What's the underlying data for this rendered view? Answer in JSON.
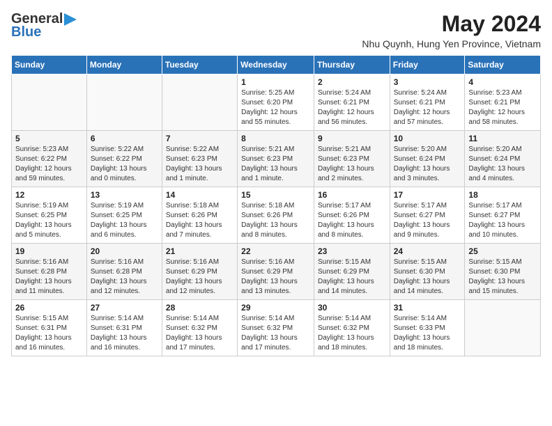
{
  "logo": {
    "line1": "General",
    "line2": "Blue",
    "arrow": "▶"
  },
  "title": {
    "month_year": "May 2024",
    "location": "Nhu Quynh, Hung Yen Province, Vietnam"
  },
  "weekdays": [
    "Sunday",
    "Monday",
    "Tuesday",
    "Wednesday",
    "Thursday",
    "Friday",
    "Saturday"
  ],
  "weeks": [
    [
      {
        "day": "",
        "info": ""
      },
      {
        "day": "",
        "info": ""
      },
      {
        "day": "",
        "info": ""
      },
      {
        "day": "1",
        "info": "Sunrise: 5:25 AM\nSunset: 6:20 PM\nDaylight: 12 hours\nand 55 minutes."
      },
      {
        "day": "2",
        "info": "Sunrise: 5:24 AM\nSunset: 6:21 PM\nDaylight: 12 hours\nand 56 minutes."
      },
      {
        "day": "3",
        "info": "Sunrise: 5:24 AM\nSunset: 6:21 PM\nDaylight: 12 hours\nand 57 minutes."
      },
      {
        "day": "4",
        "info": "Sunrise: 5:23 AM\nSunset: 6:21 PM\nDaylight: 12 hours\nand 58 minutes."
      }
    ],
    [
      {
        "day": "5",
        "info": "Sunrise: 5:23 AM\nSunset: 6:22 PM\nDaylight: 12 hours\nand 59 minutes."
      },
      {
        "day": "6",
        "info": "Sunrise: 5:22 AM\nSunset: 6:22 PM\nDaylight: 13 hours\nand 0 minutes."
      },
      {
        "day": "7",
        "info": "Sunrise: 5:22 AM\nSunset: 6:23 PM\nDaylight: 13 hours\nand 1 minute."
      },
      {
        "day": "8",
        "info": "Sunrise: 5:21 AM\nSunset: 6:23 PM\nDaylight: 13 hours\nand 1 minute."
      },
      {
        "day": "9",
        "info": "Sunrise: 5:21 AM\nSunset: 6:23 PM\nDaylight: 13 hours\nand 2 minutes."
      },
      {
        "day": "10",
        "info": "Sunrise: 5:20 AM\nSunset: 6:24 PM\nDaylight: 13 hours\nand 3 minutes."
      },
      {
        "day": "11",
        "info": "Sunrise: 5:20 AM\nSunset: 6:24 PM\nDaylight: 13 hours\nand 4 minutes."
      }
    ],
    [
      {
        "day": "12",
        "info": "Sunrise: 5:19 AM\nSunset: 6:25 PM\nDaylight: 13 hours\nand 5 minutes."
      },
      {
        "day": "13",
        "info": "Sunrise: 5:19 AM\nSunset: 6:25 PM\nDaylight: 13 hours\nand 6 minutes."
      },
      {
        "day": "14",
        "info": "Sunrise: 5:18 AM\nSunset: 6:26 PM\nDaylight: 13 hours\nand 7 minutes."
      },
      {
        "day": "15",
        "info": "Sunrise: 5:18 AM\nSunset: 6:26 PM\nDaylight: 13 hours\nand 8 minutes."
      },
      {
        "day": "16",
        "info": "Sunrise: 5:17 AM\nSunset: 6:26 PM\nDaylight: 13 hours\nand 8 minutes."
      },
      {
        "day": "17",
        "info": "Sunrise: 5:17 AM\nSunset: 6:27 PM\nDaylight: 13 hours\nand 9 minutes."
      },
      {
        "day": "18",
        "info": "Sunrise: 5:17 AM\nSunset: 6:27 PM\nDaylight: 13 hours\nand 10 minutes."
      }
    ],
    [
      {
        "day": "19",
        "info": "Sunrise: 5:16 AM\nSunset: 6:28 PM\nDaylight: 13 hours\nand 11 minutes."
      },
      {
        "day": "20",
        "info": "Sunrise: 5:16 AM\nSunset: 6:28 PM\nDaylight: 13 hours\nand 12 minutes."
      },
      {
        "day": "21",
        "info": "Sunrise: 5:16 AM\nSunset: 6:29 PM\nDaylight: 13 hours\nand 12 minutes."
      },
      {
        "day": "22",
        "info": "Sunrise: 5:16 AM\nSunset: 6:29 PM\nDaylight: 13 hours\nand 13 minutes."
      },
      {
        "day": "23",
        "info": "Sunrise: 5:15 AM\nSunset: 6:29 PM\nDaylight: 13 hours\nand 14 minutes."
      },
      {
        "day": "24",
        "info": "Sunrise: 5:15 AM\nSunset: 6:30 PM\nDaylight: 13 hours\nand 14 minutes."
      },
      {
        "day": "25",
        "info": "Sunrise: 5:15 AM\nSunset: 6:30 PM\nDaylight: 13 hours\nand 15 minutes."
      }
    ],
    [
      {
        "day": "26",
        "info": "Sunrise: 5:15 AM\nSunset: 6:31 PM\nDaylight: 13 hours\nand 16 minutes."
      },
      {
        "day": "27",
        "info": "Sunrise: 5:14 AM\nSunset: 6:31 PM\nDaylight: 13 hours\nand 16 minutes."
      },
      {
        "day": "28",
        "info": "Sunrise: 5:14 AM\nSunset: 6:32 PM\nDaylight: 13 hours\nand 17 minutes."
      },
      {
        "day": "29",
        "info": "Sunrise: 5:14 AM\nSunset: 6:32 PM\nDaylight: 13 hours\nand 17 minutes."
      },
      {
        "day": "30",
        "info": "Sunrise: 5:14 AM\nSunset: 6:32 PM\nDaylight: 13 hours\nand 18 minutes."
      },
      {
        "day": "31",
        "info": "Sunrise: 5:14 AM\nSunset: 6:33 PM\nDaylight: 13 hours\nand 18 minutes."
      },
      {
        "day": "",
        "info": ""
      }
    ]
  ]
}
